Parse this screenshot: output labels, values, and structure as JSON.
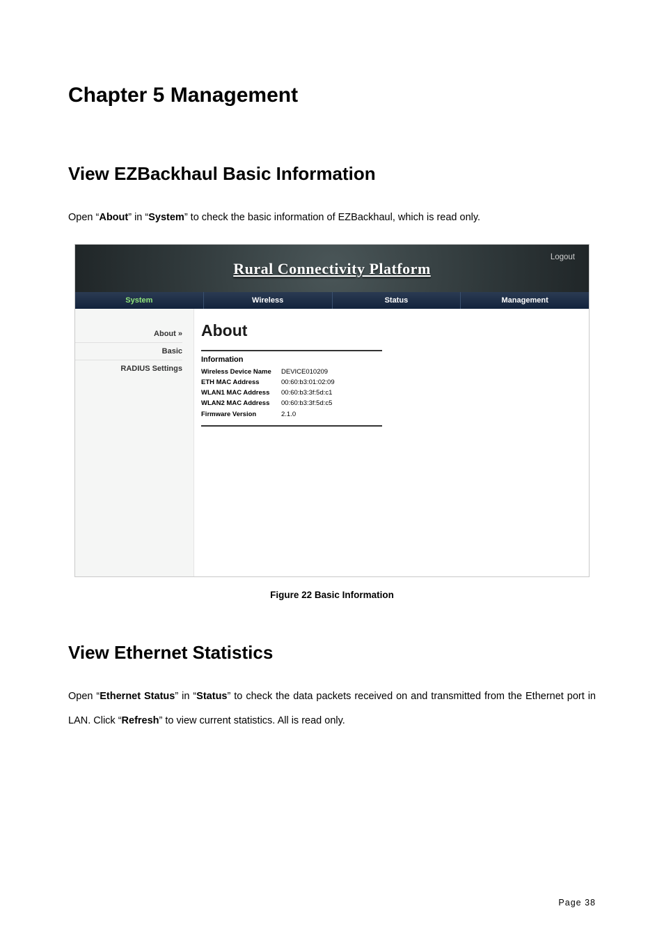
{
  "doc": {
    "chapter_title": "Chapter 5 Management",
    "section1_title": "View EZBackhaul Basic Information",
    "section1_text_parts": {
      "p1": "Open “",
      "b1": "About",
      "p2": "” in “",
      "b2": "System",
      "p3": "” to check the basic information of EZBackhaul, which is read only."
    },
    "figure_caption": "Figure 22 Basic Information",
    "section2_title": "View Ethernet Statistics",
    "section2_text_parts": {
      "p1": "Open “",
      "b1": "Ethernet Status",
      "p2": "” in “",
      "b2": "Status",
      "p3": "” to check the data packets received on and transmitted from the Ethernet port in LAN. Click “",
      "b3": "Refresh",
      "p4": "” to view current statistics. All is read only."
    },
    "page_label": "Page  38"
  },
  "screenshot": {
    "brand": "Rural Connectivity Platform",
    "logout": "Logout",
    "nav": [
      "System",
      "Wireless",
      "Status",
      "Management"
    ],
    "nav_active_index": 0,
    "sidebar": [
      {
        "label": "About  »",
        "active": true
      },
      {
        "label": "Basic"
      },
      {
        "label": "RADIUS Settings"
      }
    ],
    "main_heading": "About",
    "info_heading": "Information",
    "info_rows": [
      {
        "label": "Wireless Device Name",
        "value": "DEVICE010209"
      },
      {
        "label": "ETH MAC Address",
        "value": "00:60:b3:01:02:09"
      },
      {
        "label": "WLAN1 MAC Address",
        "value": "00:60:b3:3f:5d:c1"
      },
      {
        "label": "WLAN2 MAC Address",
        "value": "00:60:b3:3f:5d:c5"
      },
      {
        "label": "Firmware Version",
        "value": "2.1.0"
      }
    ]
  }
}
